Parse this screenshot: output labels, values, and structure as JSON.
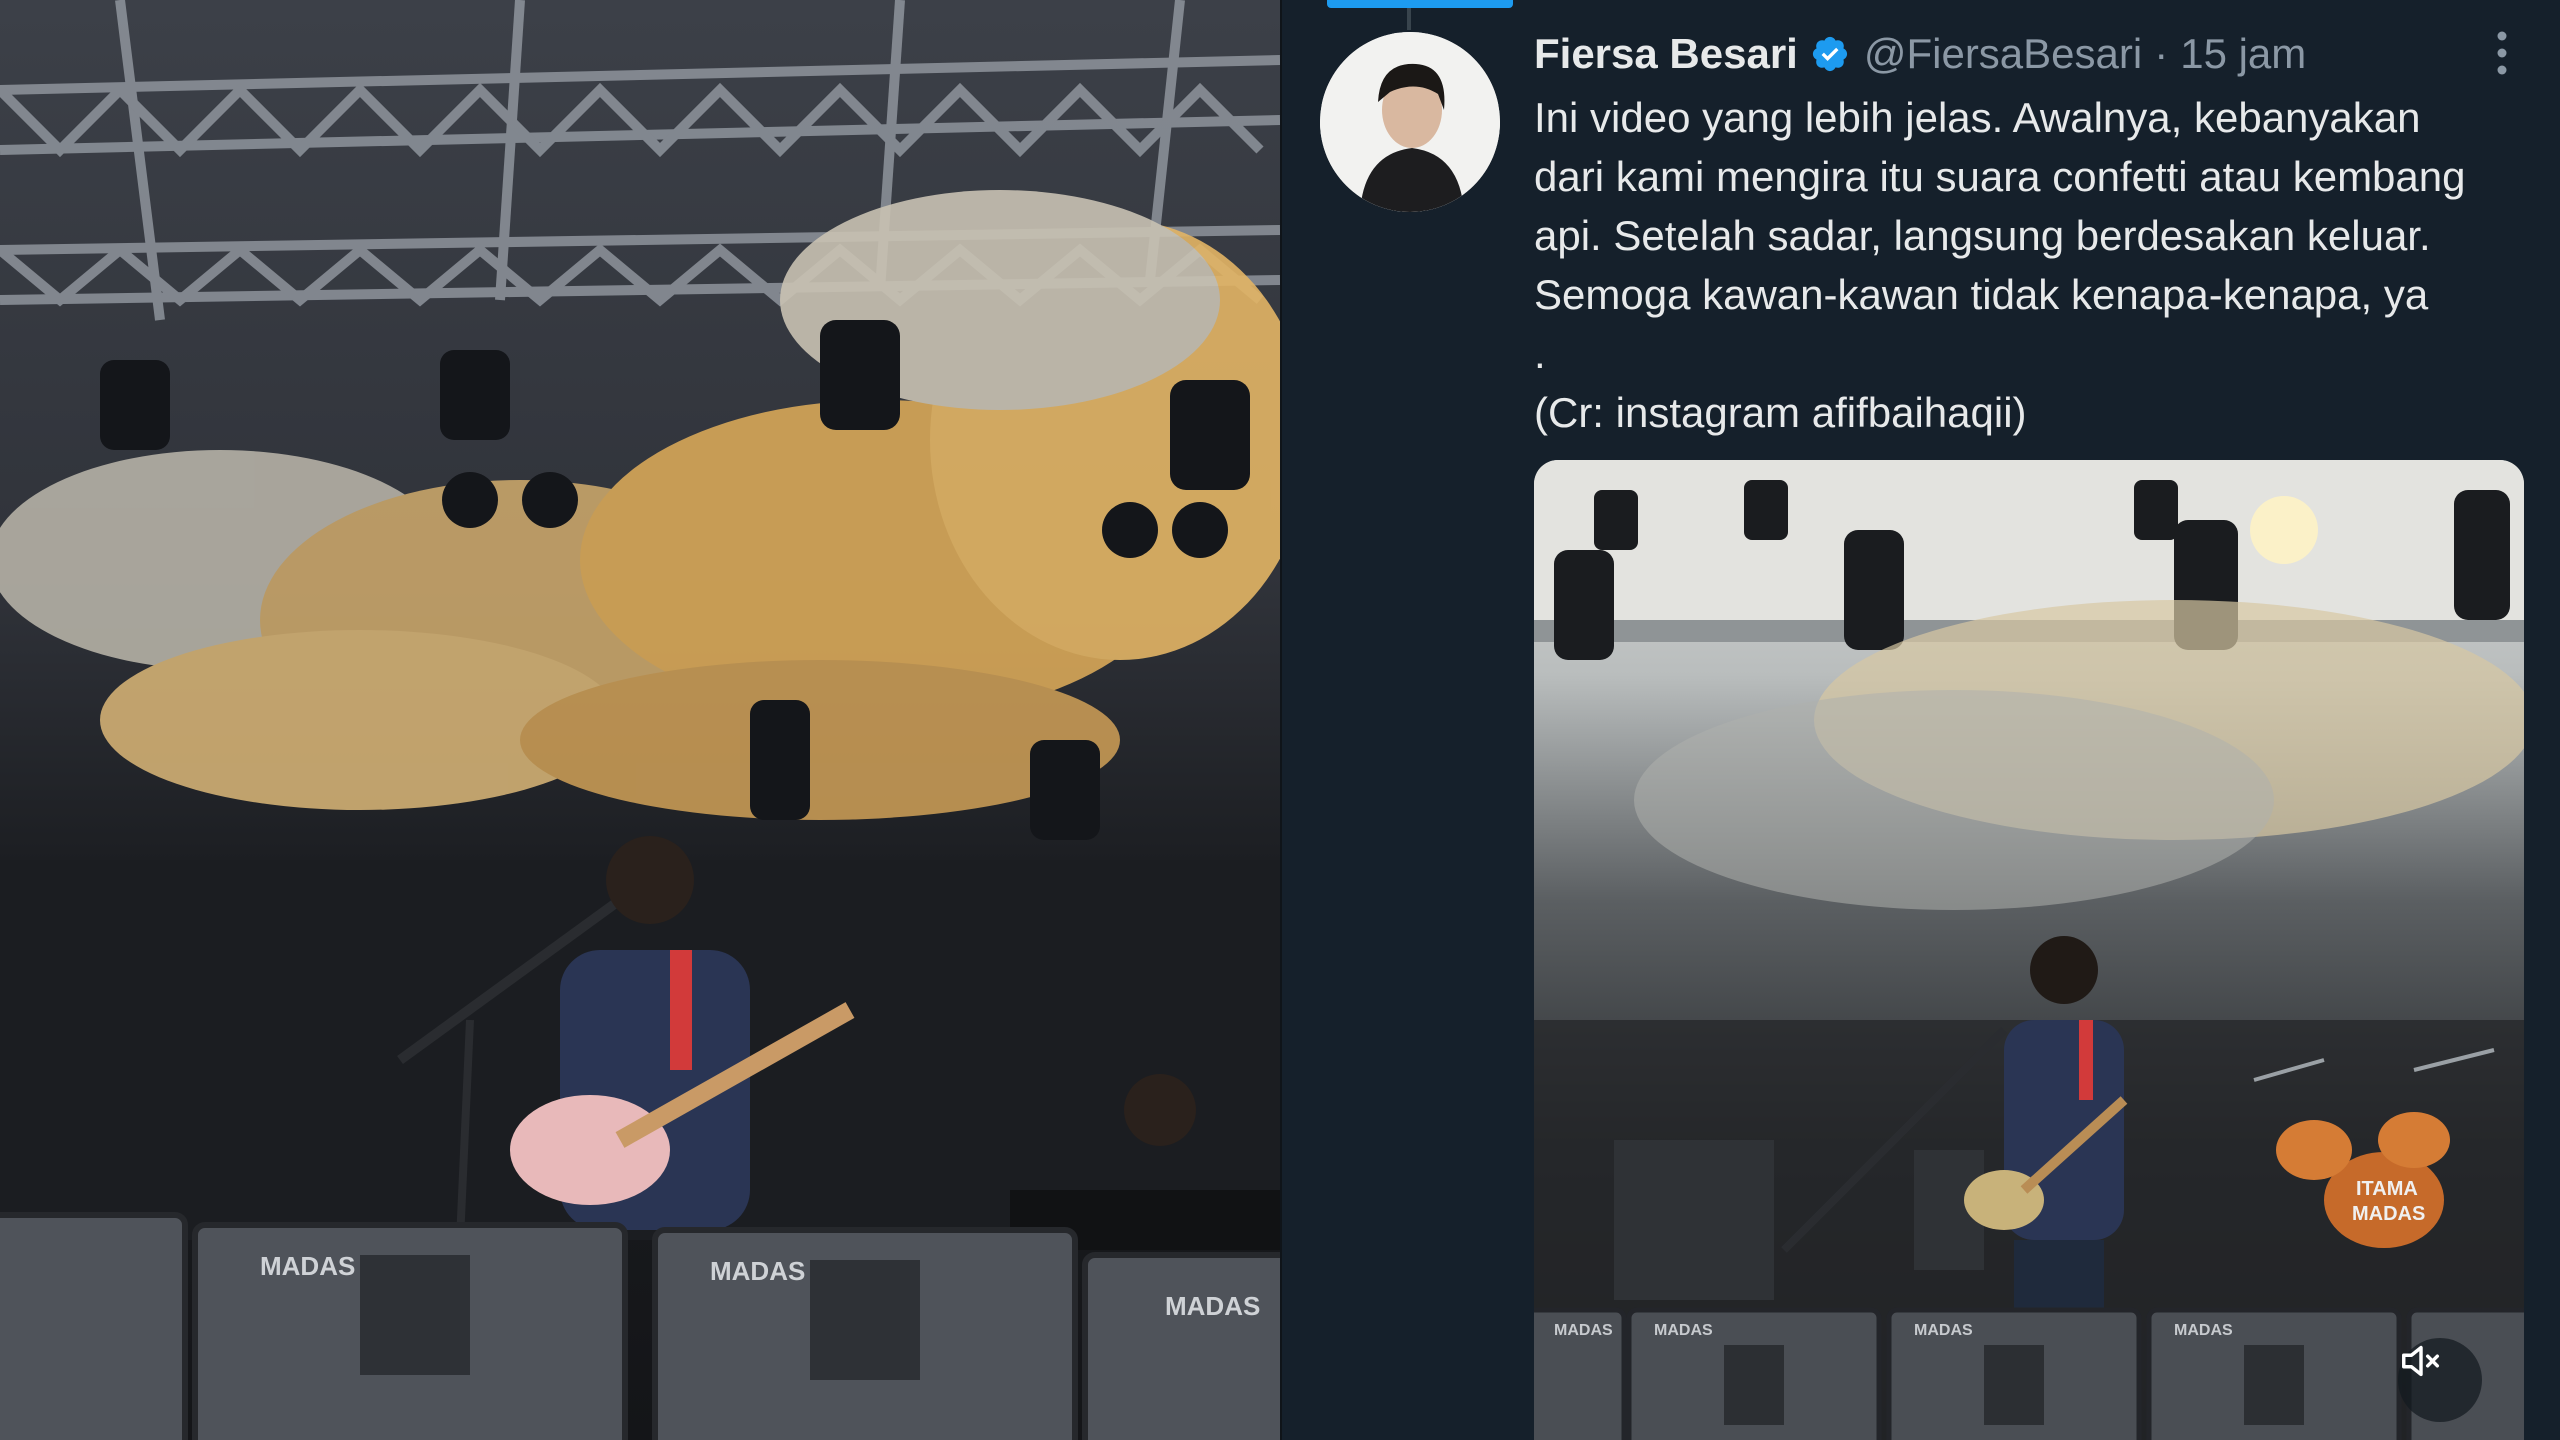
{
  "tweet": {
    "display_name": "Fiersa Besari",
    "handle": "@FiersaBesari",
    "separator": "·",
    "time": "15 jam",
    "text_lines": [
      "Ini video yang lebih jelas. Awalnya, kebanyakan",
      "dari kami mengira itu suara confetti atau kembang",
      "api. Setelah sadar, langsung berdesakan keluar.",
      "Semoga kawan-kawan tidak kenapa-kenapa, ya",
      ".",
      "(Cr: instagram afifbaihaqii)"
    ],
    "verified_icon": "verified-badge-icon",
    "more_icon": "more-options-icon",
    "mute_icon": "muted-speaker-icon"
  },
  "left_photo": {
    "speaker_brand": [
      "MADAS",
      "MADAS",
      "MADAS"
    ]
  },
  "media": {
    "speaker_brand": [
      "MADAS",
      "MADAS",
      "MADAS",
      "MADAS"
    ],
    "drum_brand": [
      "ITAMA",
      "MADAS"
    ]
  },
  "colors": {
    "background": "#15202b",
    "accent": "#1d9bf0",
    "primary_text": "#e7e9ea",
    "secondary_text": "#8b98a5"
  }
}
